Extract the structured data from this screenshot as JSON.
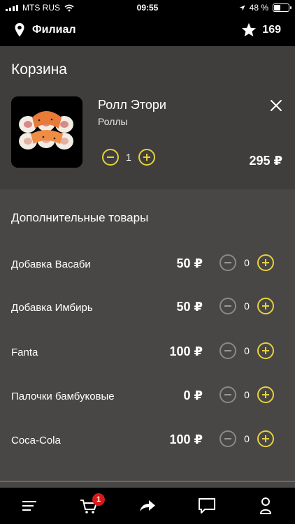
{
  "status": {
    "carrier": "MTS RUS",
    "time": "09:55",
    "battery": "48 %",
    "battery_level": 0.48
  },
  "header": {
    "branch_label": "Филиал",
    "favorites_count": "169"
  },
  "cart": {
    "title": "Корзина",
    "item": {
      "name": "Ролл Этори",
      "category": "Роллы",
      "quantity": "1",
      "price": "295 ₽"
    }
  },
  "extras": {
    "title": "Дополнительные товары",
    "items": [
      {
        "name": "Добавка Васаби",
        "price": "50 ₽",
        "quantity": "0"
      },
      {
        "name": "Добавка Имбирь",
        "price": "50 ₽",
        "quantity": "0"
      },
      {
        "name": "Fanta",
        "price": "100 ₽",
        "quantity": "0"
      },
      {
        "name": "Палочки бамбуковые",
        "price": "0 ₽",
        "quantity": "0"
      },
      {
        "name": "Coca-Cola",
        "price": "100 ₽",
        "quantity": "0"
      }
    ]
  },
  "tabbar": {
    "cart_badge": "1"
  },
  "colors": {
    "accent": "#e7d13a",
    "badge": "#d81818"
  }
}
